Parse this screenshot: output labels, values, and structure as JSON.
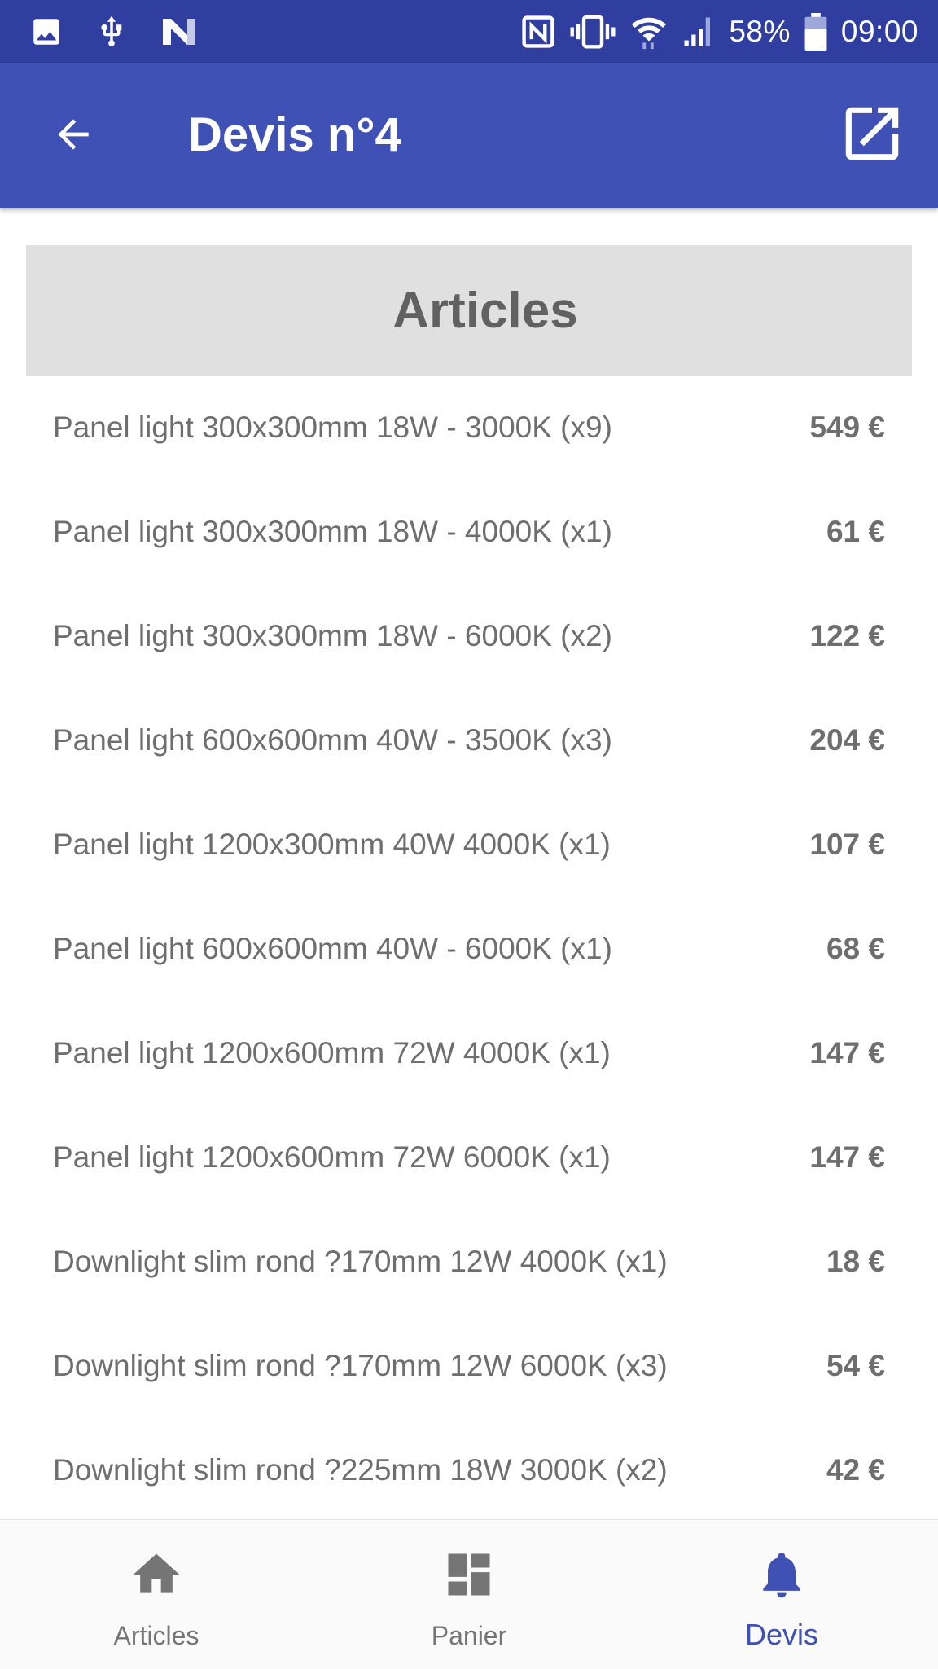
{
  "status_bar": {
    "battery": "58%",
    "time": "09:00",
    "left_icons": [
      "image-icon",
      "usb-icon",
      "n-app-icon"
    ],
    "right_icons": [
      "nfc-icon",
      "vibrate-icon",
      "wifi-icon",
      "signal-icon",
      "battery-icon"
    ]
  },
  "app_bar": {
    "title": "Devis n°4",
    "back_icon": "arrow-left-icon",
    "action_icon": "open-in-new-icon"
  },
  "section": {
    "title": "Articles"
  },
  "items": [
    {
      "name": "Panel light 300x300mm 18W - 3000K (x9)",
      "price": "549 €"
    },
    {
      "name": "Panel light 300x300mm 18W - 4000K (x1)",
      "price": "61 €"
    },
    {
      "name": "Panel light 300x300mm 18W - 6000K (x2)",
      "price": "122 €"
    },
    {
      "name": "Panel light 600x600mm 40W - 3500K (x3)",
      "price": "204 €"
    },
    {
      "name": "Panel light 1200x300mm 40W 4000K (x1)",
      "price": "107 €"
    },
    {
      "name": "Panel light 600x600mm 40W - 6000K (x1)",
      "price": "68 €"
    },
    {
      "name": "Panel light 1200x600mm 72W 4000K (x1)",
      "price": "147 €"
    },
    {
      "name": "Panel light 1200x600mm 72W 6000K (x1)",
      "price": "147 €"
    },
    {
      "name": "Downlight slim rond ?170mm 12W 4000K (x1)",
      "price": "18 €"
    },
    {
      "name": "Downlight slim rond ?170mm 12W 6000K (x3)",
      "price": "54 €"
    },
    {
      "name": "Downlight slim rond ?225mm 18W 3000K (x2)",
      "price": "42 €"
    }
  ],
  "bottom_nav": {
    "items": [
      {
        "label": "Articles",
        "icon": "home-icon",
        "active": false
      },
      {
        "label": "Panier",
        "icon": "dashboard-icon",
        "active": false
      },
      {
        "label": "Devis",
        "icon": "bell-icon",
        "active": true
      }
    ]
  },
  "colors": {
    "status_bar": "#303f9f",
    "primary": "#3f51b5",
    "section_header_bg": "#e0e0e0",
    "text": "#6e6e6e",
    "nav_inactive": "#757575",
    "nav_active": "#3f51b5"
  }
}
